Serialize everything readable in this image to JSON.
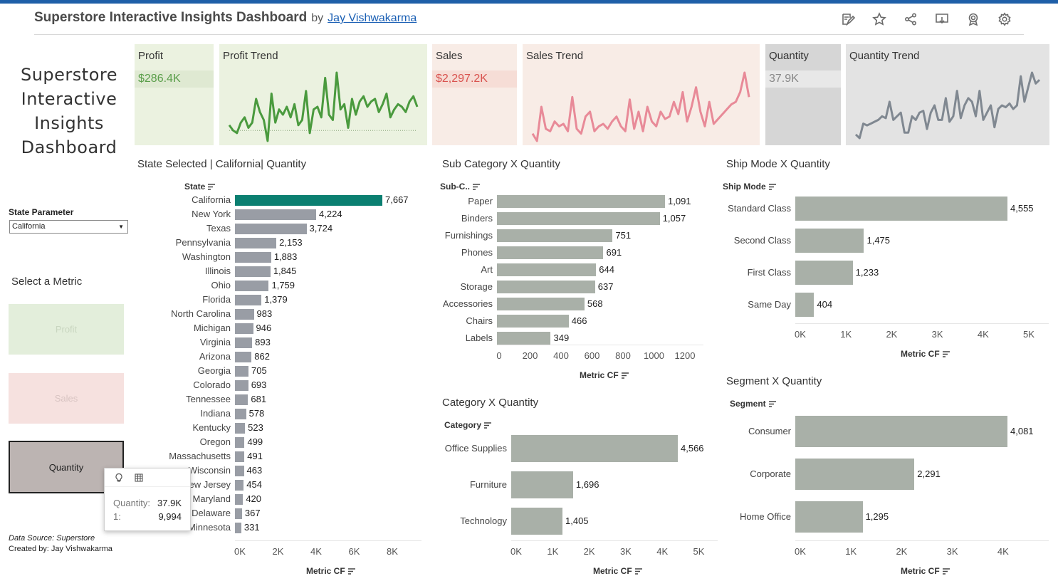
{
  "header": {
    "title": "Superstore Interactive Insights Dashboard",
    "by": "by",
    "author": "Jay Vishwakarma"
  },
  "toolbar": {
    "icons": [
      "edit-icon",
      "star-icon",
      "share-icon",
      "download-icon",
      "badge-icon",
      "gear-icon"
    ]
  },
  "side_title": [
    "Superstore",
    "Interactive",
    "Insights",
    "Dashboard"
  ],
  "kpis": {
    "profit": {
      "label": "Profit",
      "value": "$286.4K",
      "color": "#5a9e4a",
      "bg": "#ebf2e0",
      "valbg": "#dfe9d2"
    },
    "profit_trend": {
      "label": "Profit Trend",
      "bg": "#ebf2e0",
      "color": "#4a9a3e",
      "values": [
        2,
        0,
        -1,
        3,
        5,
        1,
        3,
        12,
        7,
        4,
        -4,
        14,
        3,
        8,
        6,
        9,
        5,
        10,
        2,
        4,
        15,
        -1,
        8,
        9,
        5,
        20,
        6,
        4,
        22,
        8,
        10,
        1,
        12,
        6,
        11,
        13,
        9,
        11,
        12,
        7,
        10,
        14,
        5,
        8,
        10,
        9,
        7,
        11,
        13,
        9
      ]
    },
    "sales": {
      "label": "Sales",
      "value": "$2,297.2K",
      "color": "#d9534f",
      "bg": "#f8ece6",
      "valbg": "#f6ddd6"
    },
    "sales_trend": {
      "label": "Sales Trend",
      "bg": "#f8ece6",
      "color": "#e88a98",
      "values": [
        3,
        0,
        14,
        5,
        4,
        8,
        6,
        7,
        4,
        18,
        5,
        3,
        10,
        12,
        4,
        6,
        7,
        5,
        8,
        10,
        6,
        4,
        17,
        5,
        12,
        4,
        14,
        8,
        6,
        12,
        9,
        10,
        16,
        11,
        20,
        8,
        14,
        22,
        12,
        6,
        16,
        7,
        9,
        11,
        13,
        15,
        16,
        20,
        28,
        18
      ]
    },
    "quantity": {
      "label": "Quantity",
      "value": "37.9K",
      "color": "#888888",
      "bg": "#d6d6d6",
      "valbg": "#e8e8e8"
    },
    "quantity_trend": {
      "label": "Quantity Trend",
      "bg": "#e3e3e3",
      "color": "#808891",
      "values": [
        2,
        0,
        8,
        7,
        8,
        9,
        10,
        12,
        11,
        20,
        10,
        12,
        14,
        3,
        3,
        12,
        10,
        14,
        15,
        5,
        14,
        18,
        10,
        10,
        22,
        9,
        12,
        26,
        11,
        18,
        22,
        20,
        12,
        26,
        10,
        14,
        18,
        6,
        16,
        18,
        17,
        19,
        16,
        18,
        34,
        20,
        28,
        36,
        30,
        32
      ]
    }
  },
  "state_chart": {
    "title": "State Selected | California| Quantity",
    "axis_head": "State",
    "axis_title": "Metric CF",
    "selected": "California",
    "ticks": [
      "0K",
      "2K",
      "4K",
      "6K",
      "8K"
    ],
    "rows": [
      {
        "label": "California",
        "value": 7667,
        "text": "7,667"
      },
      {
        "label": "New York",
        "value": 4224,
        "text": "4,224"
      },
      {
        "label": "Texas",
        "value": 3724,
        "text": "3,724"
      },
      {
        "label": "Pennsylvania",
        "value": 2153,
        "text": "2,153"
      },
      {
        "label": "Washington",
        "value": 1883,
        "text": "1,883"
      },
      {
        "label": "Illinois",
        "value": 1845,
        "text": "1,845"
      },
      {
        "label": "Ohio",
        "value": 1759,
        "text": "1,759"
      },
      {
        "label": "Florida",
        "value": 1379,
        "text": "1,379"
      },
      {
        "label": "North Carolina",
        "value": 983,
        "text": "983"
      },
      {
        "label": "Michigan",
        "value": 946,
        "text": "946"
      },
      {
        "label": "Virginia",
        "value": 893,
        "text": "893"
      },
      {
        "label": "Arizona",
        "value": 862,
        "text": "862"
      },
      {
        "label": "Georgia",
        "value": 705,
        "text": "705"
      },
      {
        "label": "Colorado",
        "value": 693,
        "text": "693"
      },
      {
        "label": "Tennessee",
        "value": 681,
        "text": "681"
      },
      {
        "label": "Indiana",
        "value": 578,
        "text": "578"
      },
      {
        "label": "Kentucky",
        "value": 523,
        "text": "523"
      },
      {
        "label": "Oregon",
        "value": 499,
        "text": "499"
      },
      {
        "label": "Massachusetts",
        "value": 491,
        "text": "491"
      },
      {
        "label": "Wisconsin",
        "value": 463,
        "text": "463"
      },
      {
        "label": "New Jersey",
        "value": 454,
        "text": "454"
      },
      {
        "label": "Maryland",
        "value": 420,
        "text": "420"
      },
      {
        "label": "Delaware",
        "value": 367,
        "text": "367"
      },
      {
        "label": "Minnesota",
        "value": 331,
        "text": "331"
      }
    ]
  },
  "subcat_chart": {
    "title": "Sub Category X Quantity",
    "axis_head": "Sub-C..",
    "axis_title": "Metric CF",
    "ticks": [
      "0",
      "200",
      "400",
      "600",
      "800",
      "1000",
      "1200"
    ],
    "rows": [
      {
        "label": "Paper",
        "value": 1091,
        "text": "1,091"
      },
      {
        "label": "Binders",
        "value": 1057,
        "text": "1,057"
      },
      {
        "label": "Furnishings",
        "value": 751,
        "text": "751"
      },
      {
        "label": "Phones",
        "value": 691,
        "text": "691"
      },
      {
        "label": "Art",
        "value": 644,
        "text": "644"
      },
      {
        "label": "Storage",
        "value": 637,
        "text": "637"
      },
      {
        "label": "Accessories",
        "value": 568,
        "text": "568"
      },
      {
        "label": "Chairs",
        "value": 466,
        "text": "466"
      },
      {
        "label": "Labels",
        "value": 349,
        "text": "349"
      }
    ]
  },
  "category_chart": {
    "title": "Category X Quantity",
    "axis_head": "Category",
    "axis_title": "Metric CF",
    "ticks": [
      "0K",
      "1K",
      "2K",
      "3K",
      "4K",
      "5K"
    ],
    "rows": [
      {
        "label": "Office Supplies",
        "value": 4566,
        "text": "4,566"
      },
      {
        "label": "Furniture",
        "value": 1696,
        "text": "1,696"
      },
      {
        "label": "Technology",
        "value": 1405,
        "text": "1,405"
      }
    ]
  },
  "shipmode_chart": {
    "title": "Ship Mode X Quantity",
    "axis_head": "Ship Mode",
    "axis_title": "Metric CF",
    "ticks": [
      "0K",
      "1K",
      "2K",
      "3K",
      "4K",
      "5K"
    ],
    "rows": [
      {
        "label": "Standard Class",
        "value": 4555,
        "text": "4,555"
      },
      {
        "label": "Second Class",
        "value": 1475,
        "text": "1,475"
      },
      {
        "label": "First Class",
        "value": 1233,
        "text": "1,233"
      },
      {
        "label": "Same Day",
        "value": 404,
        "text": "404"
      }
    ]
  },
  "segment_chart": {
    "title": "Segment X Quantity",
    "axis_head": "Segment",
    "axis_title": "Metric CF",
    "ticks": [
      "0K",
      "1K",
      "2K",
      "3K",
      "4K"
    ],
    "rows": [
      {
        "label": "Consumer",
        "value": 4081,
        "text": "4,081"
      },
      {
        "label": "Corporate",
        "value": 2291,
        "text": "2,291"
      },
      {
        "label": "Home Office",
        "value": 1295,
        "text": "1,295"
      }
    ]
  },
  "controls": {
    "param_label": "State Parameter",
    "param_value": "California",
    "metric_label": "Select a Metric",
    "metrics": [
      {
        "label": "Profit",
        "bg": "#e3eedb",
        "color": "#c9d6c0",
        "active": false
      },
      {
        "label": "Sales",
        "bg": "#f6e1df",
        "color": "#d8c4c2",
        "active": false
      },
      {
        "label": "Quantity",
        "bg": "#bcb4b2",
        "color": "#222222",
        "active": true
      }
    ]
  },
  "tooltip": {
    "k1": "Quantity:",
    "v1": "37.9K",
    "k2": "1:",
    "v2": "9,994"
  },
  "footer": {
    "source": "Data Source: Superstore",
    "created": "Created by:   Jay Vishwakarma"
  },
  "chart_data": [
    {
      "type": "bar",
      "title": "State Selected | California| Quantity",
      "xlabel": "Metric CF",
      "ylabel": "State",
      "categories": [
        "California",
        "New York",
        "Texas",
        "Pennsylvania",
        "Washington",
        "Illinois",
        "Ohio",
        "Florida",
        "North Carolina",
        "Michigan",
        "Virginia",
        "Arizona",
        "Georgia",
        "Colorado",
        "Tennessee",
        "Indiana",
        "Kentucky",
        "Oregon",
        "Massachusetts",
        "Wisconsin",
        "New Jersey",
        "Maryland",
        "Delaware",
        "Minnesota"
      ],
      "values": [
        7667,
        4224,
        3724,
        2153,
        1883,
        1845,
        1759,
        1379,
        983,
        946,
        893,
        862,
        705,
        693,
        681,
        578,
        523,
        499,
        491,
        463,
        454,
        420,
        367,
        331
      ],
      "xlim": [
        0,
        9000
      ]
    },
    {
      "type": "bar",
      "title": "Sub Category X Quantity",
      "xlabel": "Metric CF",
      "ylabel": "Sub-C..",
      "categories": [
        "Paper",
        "Binders",
        "Furnishings",
        "Phones",
        "Art",
        "Storage",
        "Accessories",
        "Chairs",
        "Labels"
      ],
      "values": [
        1091,
        1057,
        751,
        691,
        644,
        637,
        568,
        466,
        349
      ],
      "xlim": [
        0,
        1300
      ]
    },
    {
      "type": "bar",
      "title": "Category X Quantity",
      "xlabel": "Metric CF",
      "ylabel": "Category",
      "categories": [
        "Office Supplies",
        "Furniture",
        "Technology"
      ],
      "values": [
        4566,
        1696,
        1405
      ],
      "xlim": [
        0,
        5400
      ]
    },
    {
      "type": "bar",
      "title": "Ship Mode X Quantity",
      "xlabel": "Metric CF",
      "ylabel": "Ship Mode",
      "categories": [
        "Standard Class",
        "Second Class",
        "First Class",
        "Same Day"
      ],
      "values": [
        4555,
        1475,
        1233,
        404
      ],
      "xlim": [
        0,
        5400
      ]
    },
    {
      "type": "bar",
      "title": "Segment X Quantity",
      "xlabel": "Metric CF",
      "ylabel": "Segment",
      "categories": [
        "Consumer",
        "Corporate",
        "Home Office"
      ],
      "values": [
        4081,
        2291,
        1295
      ],
      "xlim": [
        0,
        4500
      ]
    }
  ]
}
